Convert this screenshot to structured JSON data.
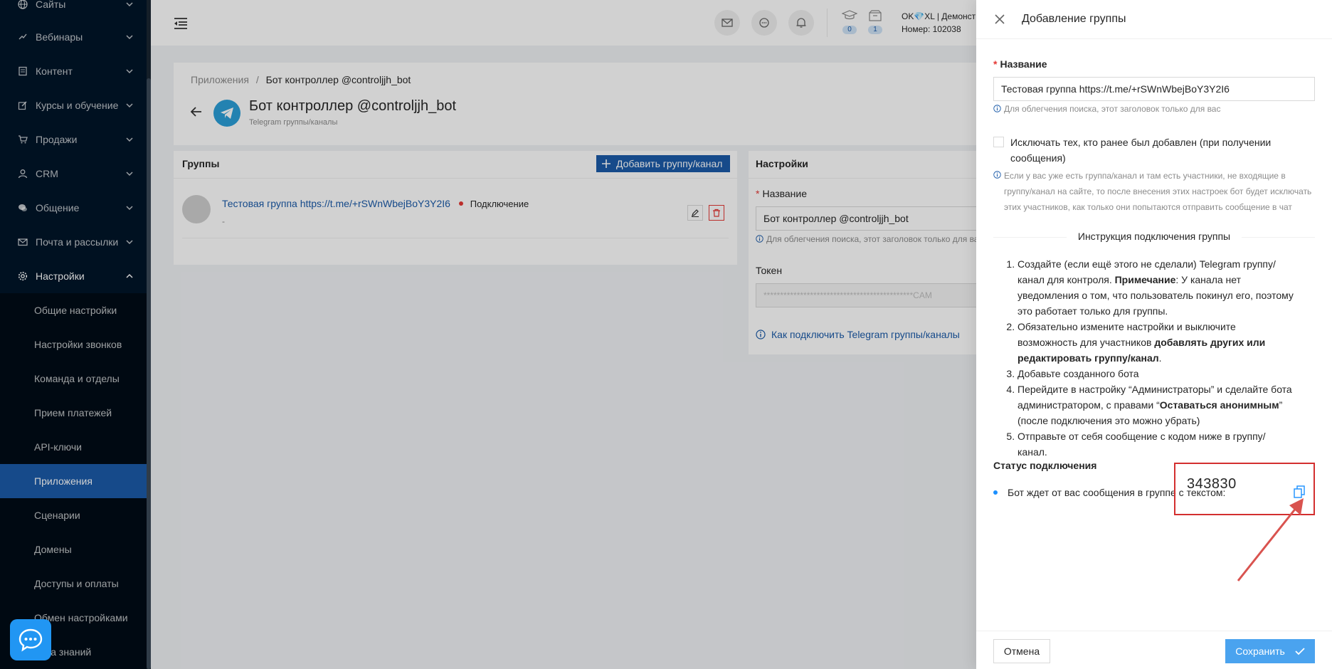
{
  "sidebar": {
    "items": [
      {
        "label": "Сайты",
        "icon": "globe-icon"
      },
      {
        "label": "Вебинары",
        "icon": "webinar-icon"
      },
      {
        "label": "Контент",
        "icon": "content-icon"
      },
      {
        "label": "Курсы и обучение",
        "icon": "edit-icon"
      },
      {
        "label": "Продажи",
        "icon": "cart-icon"
      },
      {
        "label": "CRM",
        "icon": "user-icon"
      },
      {
        "label": "Общение",
        "icon": "chat-icon"
      },
      {
        "label": "Почта и рассылки",
        "icon": "mail-icon"
      },
      {
        "label": "Настройки",
        "icon": "gear-icon"
      }
    ],
    "sub_items": [
      {
        "label": "Общие настройки"
      },
      {
        "label": "Настройки звонков"
      },
      {
        "label": "Команда и отделы"
      },
      {
        "label": "Прием платежей"
      },
      {
        "label": "API-ключи"
      },
      {
        "label": "Приложения"
      },
      {
        "label": "Сценарии"
      },
      {
        "label": "Домены"
      },
      {
        "label": "Доступы и оплаты"
      },
      {
        "label": "Обмен настройками"
      },
      {
        "label": "База знаний"
      }
    ]
  },
  "header": {
    "badge_courses": "0",
    "badge_orders": "1",
    "account_name": "OK💎XL | Демонст",
    "account_number": "Номер: 102038"
  },
  "page": {
    "breadcrumb_root": "Приложения",
    "breadcrumb_sep": "/",
    "breadcrumb_current": "Бот контроллер @controljjh_bot",
    "title": "Бот контроллер @controljjh_bot",
    "subtitle": "Telegram группы/каналы"
  },
  "groups": {
    "title": "Группы",
    "add_button": "Добавить группу/канал",
    "row_name": "Тестовая группа https://t.me/+rSWnWbejBoY3Y2I6",
    "row_status": "Подключение",
    "row_sub": "-"
  },
  "settings": {
    "title": "Настройки",
    "name_label": "Название",
    "name_value": "Бот контроллер @controljjh_bot",
    "name_hint": "Для облегчения поиска, этот заголовок только для ва",
    "token_label": "Токен",
    "token_value": "*********************************************CAM",
    "help_link": "Как подключить Telegram группы/каналы"
  },
  "drawer": {
    "title": "Добавление группы",
    "name_label": "Название",
    "name_value": "Тестовая группа https://t.me/+rSWnWbejBoY3Y2I6",
    "name_hint": "Для облегчения поиска, этот заголовок только для вас",
    "exclude_label": "Исключать тех, кто ранее был добавлен (при получении сообщения)",
    "exclude_hint": "Если у вас уже есть группа/канал и там есть участники, не входящие в группу/канал на сайте, то после внесения этих настроек бот будет исключать этих участников, как только они попытаются отправить сообщение в чат",
    "instructions_title": "Инструкция подключения группы",
    "step1_a": "Создайте (если ещё этого не сделали) Telegram группу/канал для контроля. ",
    "step1_b": "Примечание",
    "step1_c": ": У канала нет уведомления о том, что пользователь покинул его, поэтому это работает только для группы.",
    "step2_a": "Обязательно измените настройки и выключите возможность для участников ",
    "step2_b": "добавлять других или редактировать группу/канал",
    "step2_c": ".",
    "step3": "Добавьте созданного бота",
    "step4_a": "Перейдите в настройку “Администраторы” и сделайте бота администратором, с правами “",
    "step4_b": "Оставаться анонимным",
    "step4_c": "” (после подключения это можно убрать)",
    "step5": "Отправьте от себя сообщение с кодом ниже в группу/канал.",
    "status_title": "Статус подключения",
    "status_text": "Бот ждет от вас сообщения в группе с текстом:",
    "code": "343830",
    "cancel_button": "Отмена",
    "save_button": "Сохранить"
  },
  "colors": {
    "sidebar_bg": "#001529",
    "active_item": "#1b5ba9",
    "primary": "#1b5ba9",
    "save_button": "#4aa3ef",
    "danger": "#e53935",
    "highlight_box": "#d32f2f"
  }
}
